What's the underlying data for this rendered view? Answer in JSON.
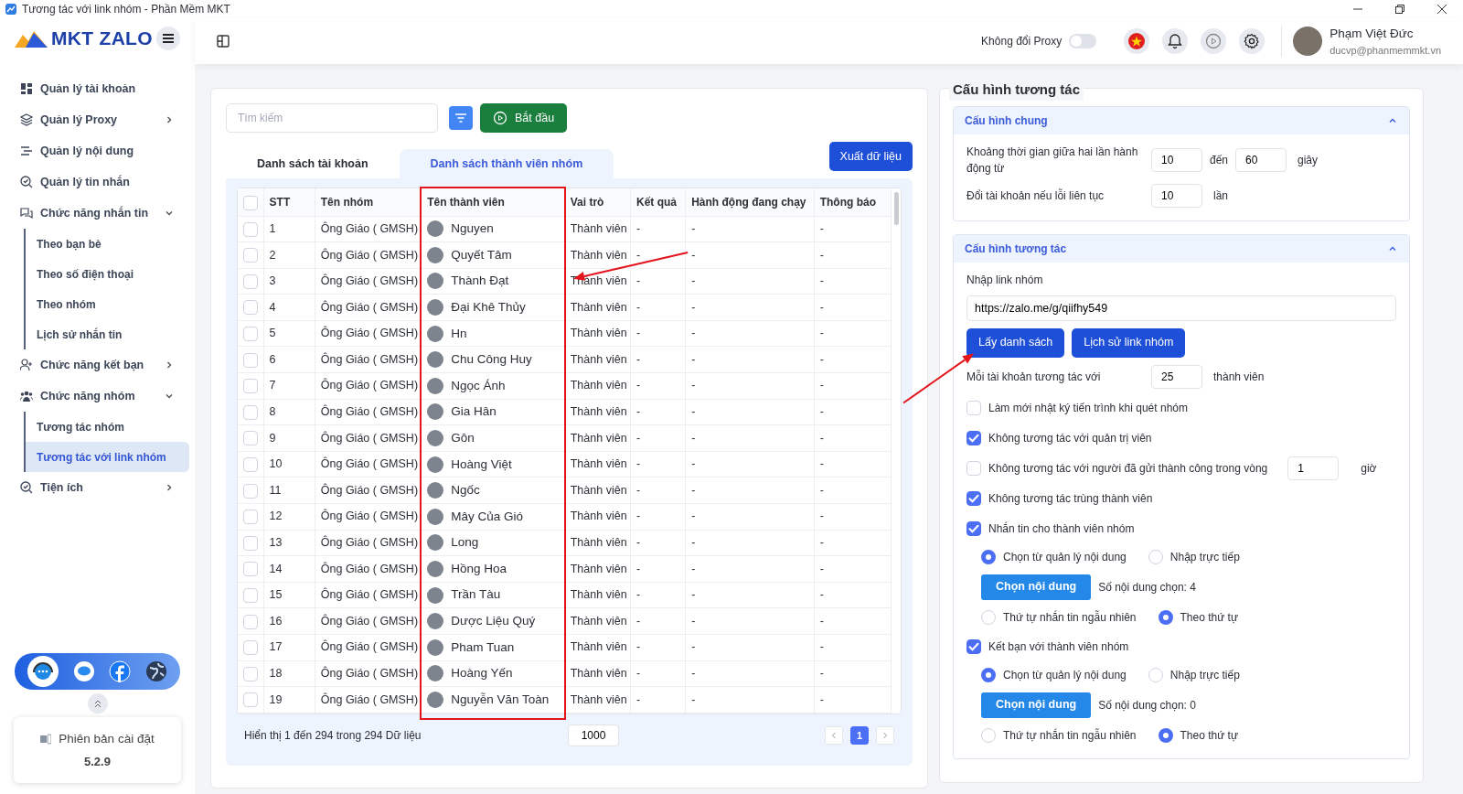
{
  "window": {
    "title": "Tương tác với link nhóm - Phần Mềm MKT"
  },
  "sidebar": {
    "logo": "MKT ZALO",
    "items": [
      {
        "label": "Quản lý tài khoản",
        "selected": false
      },
      {
        "label": "Quản lý Proxy",
        "selected": false,
        "expanded": false
      },
      {
        "label": "Quản lý nội dung",
        "selected": false
      },
      {
        "label": "Quản lý tin nhắn",
        "selected": false
      },
      {
        "label": "Chức năng nhắn tin",
        "selected": false,
        "expanded": true,
        "children": [
          {
            "label": "Theo bạn bè",
            "selected": false
          },
          {
            "label": "Theo số điện thoại",
            "selected": false
          },
          {
            "label": "Theo nhóm",
            "selected": false
          },
          {
            "label": "Lịch sử nhắn tin",
            "selected": false
          }
        ]
      },
      {
        "label": "Chức năng kết bạn",
        "selected": false,
        "expanded": false
      },
      {
        "label": "Chức năng nhóm",
        "selected": false,
        "expanded": true,
        "children": [
          {
            "label": "Tương tác nhóm",
            "selected": false
          },
          {
            "label": "Tương tác với link nhóm",
            "selected": true
          }
        ]
      },
      {
        "label": "Tiện ích",
        "selected": false,
        "expanded": false
      }
    ],
    "version_label": "Phiên bản cài đặt",
    "version": "5.2.9"
  },
  "header": {
    "proxy_label": "Không đổi Proxy",
    "proxy_on": false,
    "user_name": "Phạm Việt Đức",
    "user_email": "ducvp@phanmemmkt.vn"
  },
  "members": {
    "search_placeholder": "Tìm kiếm",
    "start_button": "Bắt đầu",
    "export_button": "Xuất dữ liệu",
    "tabs": [
      {
        "label": "Danh sách tài khoản",
        "selected": false
      },
      {
        "label": "Danh sách thành viên nhóm",
        "selected": true
      }
    ],
    "all_checked": false,
    "columns": [
      "STT",
      "Tên nhóm",
      "Tên thành viên",
      "Vai trò",
      "Kết quả",
      "Hành động đang chạy",
      "Thông báo"
    ],
    "rows": [
      {
        "stt": "1",
        "group": "Ông Giáo ( GMSH)",
        "member": "Nguyen",
        "role": "Thành viên",
        "result": "-",
        "action": "-",
        "notice": "-",
        "checked": false
      },
      {
        "stt": "2",
        "group": "Ông Giáo ( GMSH)",
        "member": "Quyết Tâm",
        "role": "Thành viên",
        "result": "-",
        "action": "-",
        "notice": "-",
        "checked": false
      },
      {
        "stt": "3",
        "group": "Ông Giáo ( GMSH)",
        "member": "Thành Đạt",
        "role": "Thành viên",
        "result": "-",
        "action": "-",
        "notice": "-",
        "checked": false
      },
      {
        "stt": "4",
        "group": "Ông Giáo ( GMSH)",
        "member": "Đại Khê Thủy",
        "role": "Thành viên",
        "result": "-",
        "action": "-",
        "notice": "-",
        "checked": false
      },
      {
        "stt": "5",
        "group": "Ông Giáo ( GMSH)",
        "member": "Hn",
        "role": "Thành viên",
        "result": "-",
        "action": "-",
        "notice": "-",
        "checked": false
      },
      {
        "stt": "6",
        "group": "Ông Giáo ( GMSH)",
        "member": "Chu Công Huy",
        "role": "Thành viên",
        "result": "-",
        "action": "-",
        "notice": "-",
        "checked": false
      },
      {
        "stt": "7",
        "group": "Ông Giáo ( GMSH)",
        "member": "Ngọc Ánh",
        "role": "Thành viên",
        "result": "-",
        "action": "-",
        "notice": "-",
        "checked": false
      },
      {
        "stt": "8",
        "group": "Ông Giáo ( GMSH)",
        "member": "Gia Hân",
        "role": "Thành viên",
        "result": "-",
        "action": "-",
        "notice": "-",
        "checked": false
      },
      {
        "stt": "9",
        "group": "Ông Giáo ( GMSH)",
        "member": "Gôn",
        "role": "Thành viên",
        "result": "-",
        "action": "-",
        "notice": "-",
        "checked": false
      },
      {
        "stt": "10",
        "group": "Ông Giáo ( GMSH)",
        "member": "Hoàng Việt",
        "role": "Thành viên",
        "result": "-",
        "action": "-",
        "notice": "-",
        "checked": false
      },
      {
        "stt": "11",
        "group": "Ông Giáo ( GMSH)",
        "member": "Ngốc",
        "role": "Thành viên",
        "result": "-",
        "action": "-",
        "notice": "-",
        "checked": false
      },
      {
        "stt": "12",
        "group": "Ông Giáo ( GMSH)",
        "member": "Mây Của Gió",
        "role": "Thành viên",
        "result": "-",
        "action": "-",
        "notice": "-",
        "checked": false
      },
      {
        "stt": "13",
        "group": "Ông Giáo ( GMSH)",
        "member": "Long",
        "role": "Thành viên",
        "result": "-",
        "action": "-",
        "notice": "-",
        "checked": false
      },
      {
        "stt": "14",
        "group": "Ông Giáo ( GMSH)",
        "member": "Hồng Hoa",
        "role": "Thành viên",
        "result": "-",
        "action": "-",
        "notice": "-",
        "checked": false
      },
      {
        "stt": "15",
        "group": "Ông Giáo ( GMSH)",
        "member": "Trần Tàu",
        "role": "Thành viên",
        "result": "-",
        "action": "-",
        "notice": "-",
        "checked": false
      },
      {
        "stt": "16",
        "group": "Ông Giáo ( GMSH)",
        "member": "Dược Liệu Quý",
        "role": "Thành viên",
        "result": "-",
        "action": "-",
        "notice": "-",
        "checked": false
      },
      {
        "stt": "17",
        "group": "Ông Giáo ( GMSH)",
        "member": "Pham Tuan",
        "role": "Thành viên",
        "result": "-",
        "action": "-",
        "notice": "-",
        "checked": false
      },
      {
        "stt": "18",
        "group": "Ông Giáo ( GMSH)",
        "member": "Hoàng Yến",
        "role": "Thành viên",
        "result": "-",
        "action": "-",
        "notice": "-",
        "checked": false
      },
      {
        "stt": "19",
        "group": "Ông Giáo ( GMSH)",
        "member": "Nguyễn Văn Toàn",
        "role": "Thành viên",
        "result": "-",
        "action": "-",
        "notice": "-",
        "checked": false
      }
    ],
    "footer_text": "Hiển thị 1 đến 294 trong 294 Dữ liệu",
    "page_size": "1000",
    "pages": [
      {
        "label": "1",
        "selected": true
      }
    ]
  },
  "config": {
    "title": "Cấu hình tương tác",
    "sections": [
      {
        "title": "Cấu hình chung",
        "expanded": true,
        "items": [
          {
            "kind": "range",
            "label": "Khoảng thời gian giữa hai lần hành động từ",
            "from": "10",
            "separator": "đến",
            "to": "60",
            "unit": "giây"
          },
          {
            "kind": "number",
            "label": "Đổi tài khoản nếu lỗi liên tục",
            "value": "10",
            "unit": "lần"
          }
        ]
      },
      {
        "title": "Cấu hình tương tác",
        "expanded": true,
        "items": [
          {
            "kind": "link",
            "label": "Nhập link nhóm",
            "value": "https://zalo.me/g/qiifhy549"
          },
          {
            "kind": "buttons",
            "buttons": [
              "Lấy danh sách",
              "Lịch sử link nhóm"
            ]
          },
          {
            "kind": "number",
            "label": "Mỗi tài khoản tương tác với",
            "value": "25",
            "unit": "thành viên"
          },
          {
            "kind": "checkbox",
            "label": "Làm mới nhật ký tiến trình khi quét nhóm",
            "checked": false
          },
          {
            "kind": "checkbox",
            "label": "Không tương tác với quản trị viên",
            "checked": true
          },
          {
            "kind": "checkbox",
            "label": "Không tương tác với người đã gửi thành công trong vòng",
            "checked": false,
            "value": "1",
            "unit": "giờ"
          },
          {
            "kind": "checkbox",
            "label": "Không tương tác trùng thành viên",
            "checked": true
          },
          {
            "kind": "checkbox",
            "label": "Nhắn tin cho thành viên nhóm",
            "checked": true,
            "children": [
              {
                "kind": "radios",
                "options": [
                  {
                    "label": "Chọn từ quản lý nội dung",
                    "selected": true
                  },
                  {
                    "label": "Nhập trực tiếp",
                    "selected": false
                  }
                ]
              },
              {
                "kind": "picker",
                "button": "Chọn nội dung",
                "count": "Số nội dung chọn: 4"
              },
              {
                "kind": "radios",
                "options": [
                  {
                    "label": "Thứ tự nhắn tin ngẫu nhiên",
                    "selected": false
                  },
                  {
                    "label": "Theo thứ tự",
                    "selected": true
                  }
                ]
              }
            ]
          },
          {
            "kind": "checkbox",
            "label": "Kết bạn với thành viên nhóm",
            "checked": true,
            "children": [
              {
                "kind": "radios",
                "options": [
                  {
                    "label": "Chọn từ quản lý nội dung",
                    "selected": true
                  },
                  {
                    "label": "Nhập trực tiếp",
                    "selected": false
                  }
                ]
              },
              {
                "kind": "picker",
                "button": "Chọn nội dung",
                "count": "Số nội dung chọn: 0"
              },
              {
                "kind": "radios",
                "options": [
                  {
                    "label": "Thứ tự nhắn tin ngẫu nhiên",
                    "selected": false
                  },
                  {
                    "label": "Theo thứ tự",
                    "selected": true
                  }
                ]
              }
            ]
          }
        ]
      }
    ]
  }
}
